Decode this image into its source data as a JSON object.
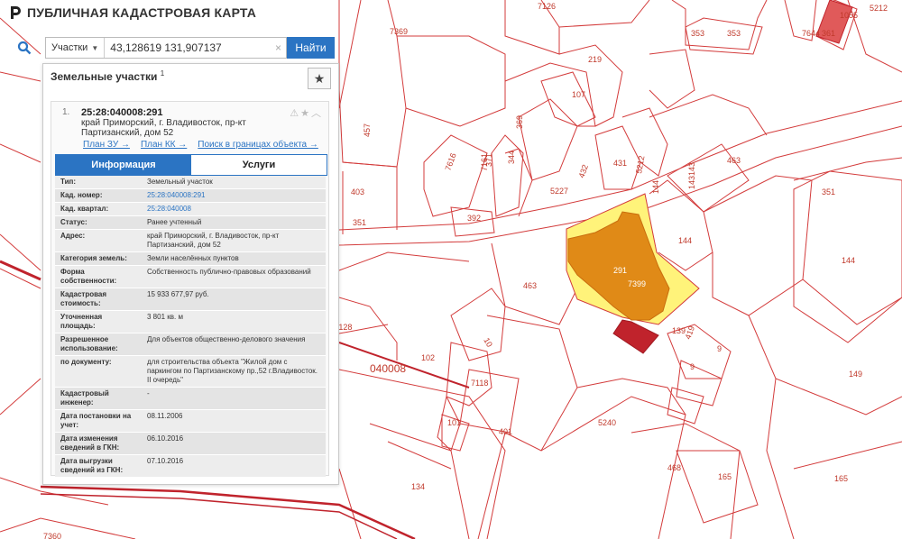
{
  "app": {
    "title": "ПУБЛИЧНАЯ КАДАСТРОВАЯ КАРТА",
    "accent": "#2b74c3"
  },
  "search": {
    "category": "Участки",
    "value": "43,128619 131,907137",
    "button": "Найти",
    "search_icon": "search-icon",
    "clear_icon": "close-icon"
  },
  "panel": {
    "title": "Земельные участки",
    "count": "1",
    "item": {
      "index": "1.",
      "cad_number": "25:28:040008:291",
      "address": "край Приморский, г. Владивосток, пр-кт Партизанский, дом 52",
      "links": [
        "План ЗУ →",
        "План КК →",
        "Поиск в границах объекта →"
      ],
      "tabs": [
        "Информация",
        "Услуги"
      ],
      "fields": [
        {
          "label": "Тип:",
          "value": "Земельный участок"
        },
        {
          "label": "Кад. номер:",
          "value": "25:28:040008:291",
          "link": true
        },
        {
          "label": "Кад. квартал:",
          "value": "25:28:040008",
          "link": true
        },
        {
          "label": "Статус:",
          "value": "Ранее учтенный"
        },
        {
          "label": "Адрес:",
          "value": "край Приморский, г. Владивосток, пр-кт Партизанский, дом 52"
        },
        {
          "label": "Категория земель:",
          "value": "Земли населённых пунктов"
        },
        {
          "label": "Форма собственности:",
          "value": "Собственность публично-правовых образований"
        },
        {
          "label": "Кадастровая стоимость:",
          "value": "15 933 677,97 руб."
        },
        {
          "label": "Уточненная площадь:",
          "value": "3 801 кв. м"
        },
        {
          "label": "Разрешенное использование:",
          "value": "Для объектов общественно-делового значения"
        },
        {
          "label": "по документу:",
          "value": "для строительства объекта \"Жилой дом с паркингом по Партизанскому пр.,52 г.Владивосток. II очередь\""
        },
        {
          "label": "Кадастровый инженер:",
          "value": "-"
        },
        {
          "label": "Дата постановки на учет:",
          "value": "08.11.2006"
        },
        {
          "label": "Дата изменения сведений в ГКН:",
          "value": "06.10.2016"
        },
        {
          "label": "Дата выгрузки сведений из ГКН:",
          "value": "07.10.2016"
        }
      ]
    }
  },
  "map": {
    "quarter": "040008",
    "plots": [
      "7126",
      "353",
      "353",
      "7369",
      "1055",
      "361",
      "7644",
      "5212",
      "219",
      "107",
      "369",
      "457",
      "431",
      "344",
      "371",
      "7161",
      "7616",
      "392",
      "5227",
      "432",
      "5212",
      "143",
      "143",
      "144",
      "403",
      "351",
      "351",
      "463",
      "144",
      "144",
      "463",
      "139",
      "419",
      "9",
      "9",
      "10",
      "102",
      "7118",
      "101",
      "401",
      "5240",
      "149",
      "468",
      "165",
      "165",
      "134",
      "7360",
      "1128",
      "84"
    ],
    "highlight_plot": "291",
    "highlight_building": "7399",
    "colors": {
      "boundary": "#d33b3b",
      "plot_fill": "#fff37a",
      "building_fill": "#e08a17",
      "dark_red": "#c0232c"
    }
  }
}
